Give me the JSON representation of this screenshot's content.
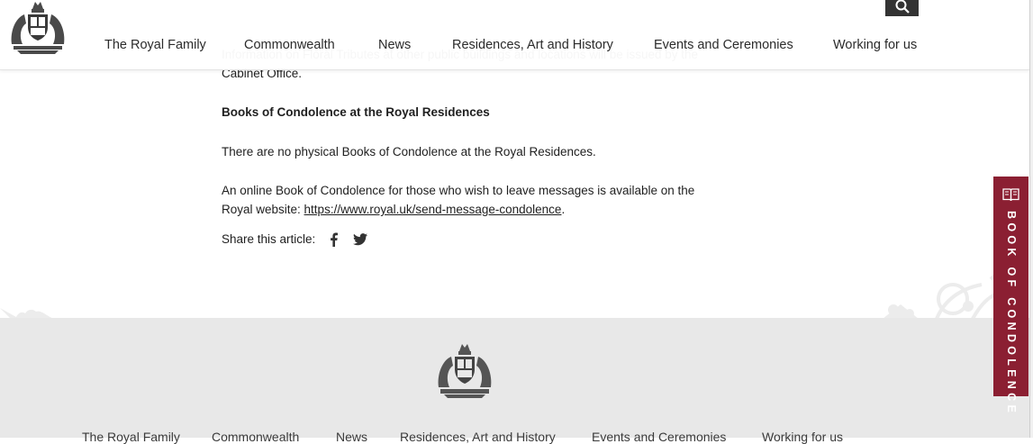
{
  "article": {
    "faded_text": "Information on Floral Tributes at other public buildings and locations will be issued by the Cabinet Office.",
    "heading": "Books of Condolence at the Royal Residences",
    "no_books_text": "There are no physical Books of Condolence at the Royal Residences.",
    "online_text": "An online Book of Condolence for those who wish to leave messages is available on the Royal website: ",
    "online_link": "https://www.royal.uk/send-message-condolence",
    "online_end": ".",
    "share_label": "Share this article:"
  },
  "header": {
    "logo_icon": "royal-coat-of-arms-icon",
    "search_icon": "search-icon",
    "nav": [
      {
        "label": "The Royal Family"
      },
      {
        "label": "Commonwealth"
      },
      {
        "label": "News"
      },
      {
        "label": "Residences, Art and History"
      },
      {
        "label": "Events and Ceremonies"
      },
      {
        "label": "Working for us"
      }
    ]
  },
  "side_tab": {
    "label": "BOOK OF CONDOLENCE",
    "icon": "book-icon",
    "color": "#8b1f32"
  },
  "footer": {
    "logo_icon": "royal-coat-of-arms-icon",
    "nav": [
      {
        "label": "The Royal Family"
      },
      {
        "label": "Commonwealth"
      },
      {
        "label": "News"
      },
      {
        "label": "Residences, Art and History"
      },
      {
        "label": "Events and Ceremonies"
      },
      {
        "label": "Working for us"
      }
    ]
  }
}
